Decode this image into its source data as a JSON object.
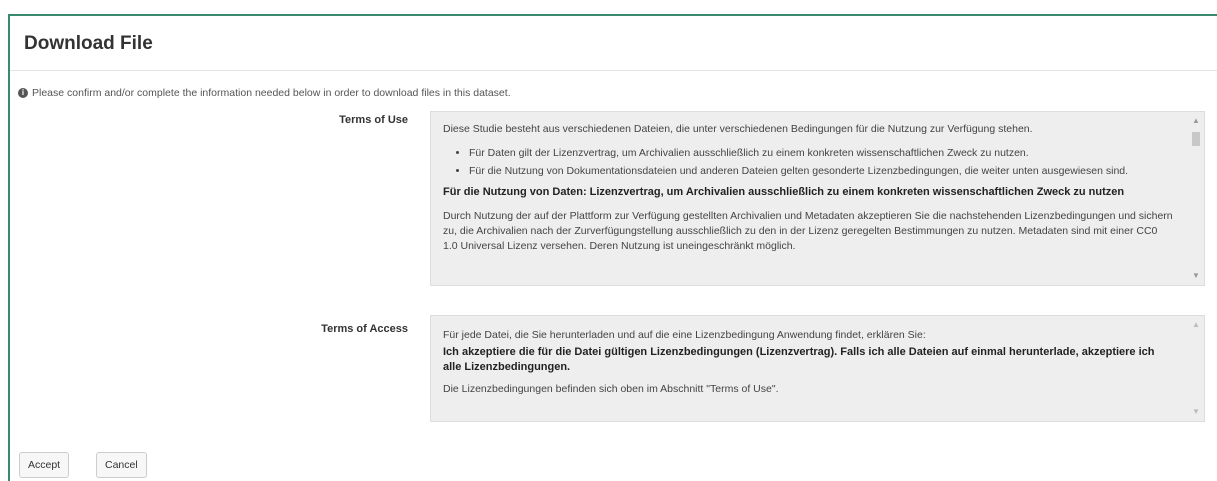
{
  "dialog": {
    "title": "Download File",
    "info_text": "Please confirm and/or complete the information needed below in order to download files in this dataset."
  },
  "terms_of_use": {
    "label": "Terms of Use",
    "intro": "Diese Studie besteht aus verschiedenen Dateien, die unter verschiedenen Bedingungen für die Nutzung zur Verfügung stehen.",
    "bullets": [
      "Für Daten gilt der Lizenzvertrag, um Archivalien ausschließlich zu einem konkreten wissenschaftlichen Zweck zu nutzen.",
      "Für die Nutzung von Dokumentationsdateien und anderen Dateien gelten gesonderte Lizenzbedingungen, die weiter unten ausgewiesen sind."
    ],
    "heading": "Für die Nutzung von Daten: Lizenzvertrag, um Archivalien ausschließlich zu einem konkreten wissenschaftlichen Zweck zu nutzen",
    "paragraph": "Durch Nutzung der auf der Plattform zur Verfügung gestellten Archivalien und Metadaten akzeptieren Sie die nachstehenden Lizenzbedingungen und sichern zu, die Archivalien nach der Zurverfügungstellung ausschließlich zu den in der Lizenz geregelten Bestimmungen zu nutzen. Metadaten sind mit einer CC0 1.0 Universal Lizenz versehen. Deren Nutzung ist uneingeschränkt möglich."
  },
  "terms_of_access": {
    "label": "Terms of Access",
    "intro": "Für jede Datei, die Sie herunterladen und auf die eine Lizenzbedingung Anwendung findet, erklären Sie:",
    "bold_text": "Ich akzeptiere die für die Datei gültigen Lizenzbedingungen (Lizenzvertrag). Falls ich alle Dateien auf einmal herunterlade, akzeptiere ich alle Lizenzbedingungen.",
    "note": "Die Lizenzbedingungen befinden sich oben im Abschnitt \"Terms of Use\"."
  },
  "buttons": {
    "accept": "Accept",
    "cancel": "Cancel"
  },
  "icons": {
    "info": "info-circle-icon",
    "scroll_up": "chevron-up-icon",
    "scroll_down": "chevron-down-icon"
  },
  "colors": {
    "accent_border": "#3a8a6e",
    "box_background": "#eeeeee"
  }
}
